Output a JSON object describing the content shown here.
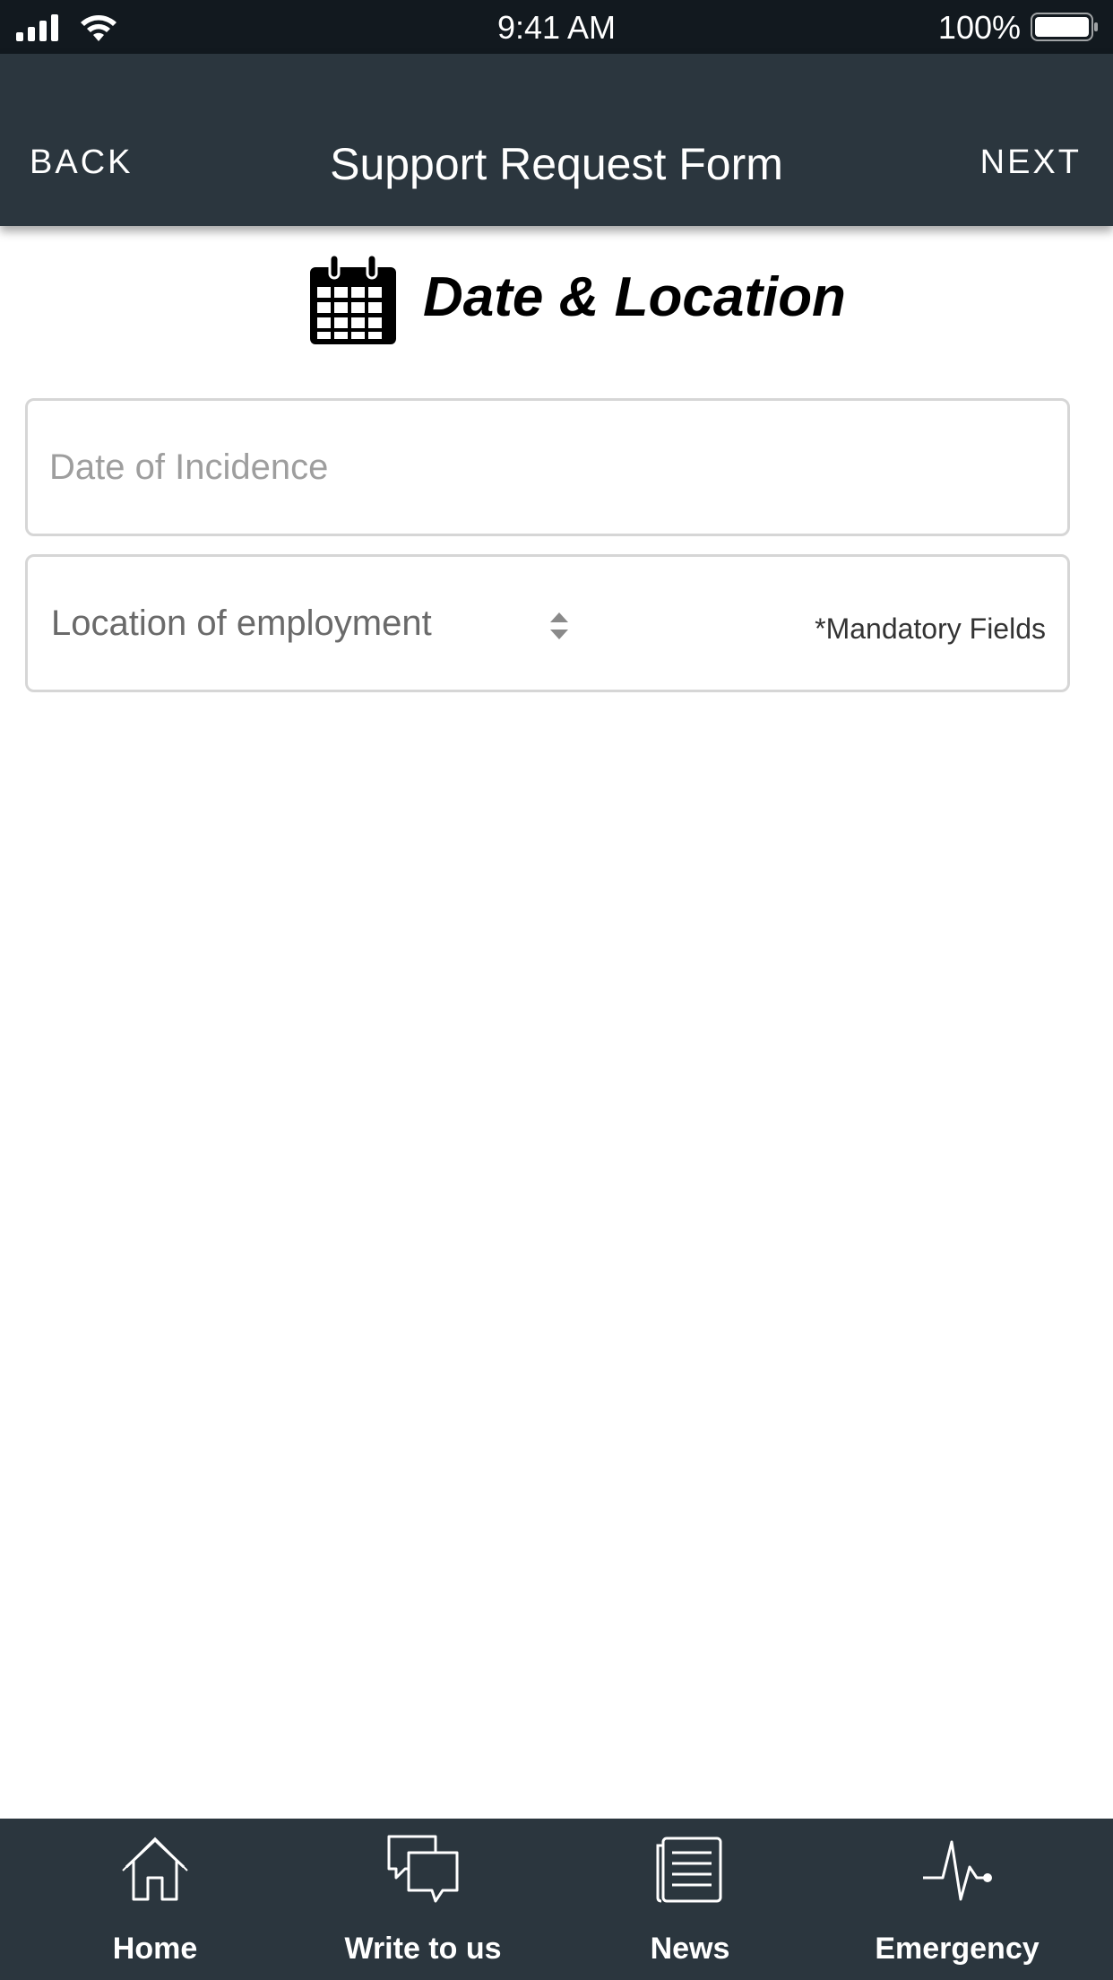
{
  "status_bar": {
    "time": "9:41 AM",
    "battery": "100%"
  },
  "nav": {
    "back": "BACK",
    "title": "Support Request Form",
    "next": "NEXT"
  },
  "section": {
    "icon": "calendar-icon",
    "title": "Date & Location"
  },
  "form": {
    "date_placeholder": "Date of Incidence",
    "date_value": "",
    "location_label": "Location of employment",
    "mandatory_note": "*Mandatory Fields"
  },
  "tabs": [
    {
      "label": "Home",
      "icon": "home-icon"
    },
    {
      "label": "Write to us",
      "icon": "chat-bubbles-icon"
    },
    {
      "label": "News",
      "icon": "newspaper-icon"
    },
    {
      "label": "Emergency",
      "icon": "heartbeat-icon"
    }
  ],
  "colors": {
    "status_bar": "#12191f",
    "nav_bar": "#2b363e",
    "tab_bar": "#2b363e",
    "field_border": "#d6d6d6"
  }
}
